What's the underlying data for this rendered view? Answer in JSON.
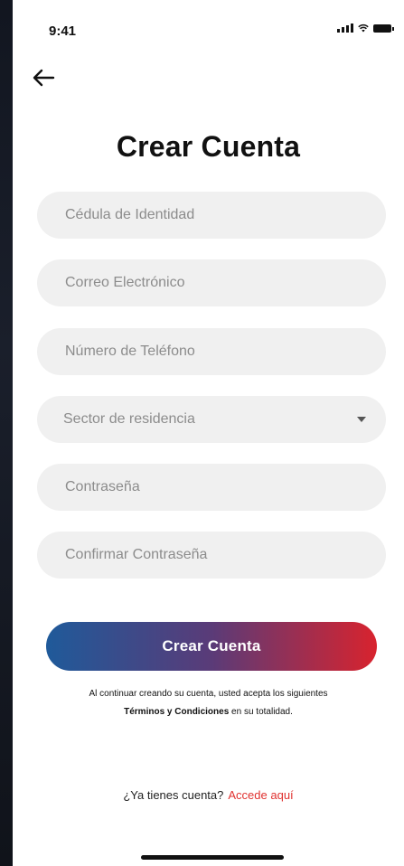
{
  "status_bar": {
    "time": "9:41"
  },
  "header": {
    "back_icon": "arrow-left-icon",
    "title": "Crear Cuenta"
  },
  "form": {
    "fields": [
      {
        "placeholder": "Cédula de Identidad",
        "type": "text"
      },
      {
        "placeholder": "Correo Electrónico",
        "type": "email"
      },
      {
        "placeholder": "Número de Teléfono",
        "type": "tel"
      },
      {
        "placeholder": "Sector de residencia",
        "type": "select",
        "icon": "caret-down-icon"
      },
      {
        "placeholder": "Contraseña",
        "type": "password"
      },
      {
        "placeholder": "Confirmar Contraseña",
        "type": "password"
      }
    ],
    "submit_label": "Crear Cuenta",
    "terms_text_1": "Al continuar creando su cuenta, usted acepta los siguientes",
    "terms_link": "Términos y Condiciones",
    "terms_text_2": "en su totalidad."
  },
  "footer": {
    "question": "¿Ya tienes cuenta?",
    "link": "Accede aquí"
  },
  "colors": {
    "gradient_start": "#1f5a9a",
    "gradient_end": "#d8232e",
    "link": "#e0312f",
    "field_bg": "#f0f0f0"
  }
}
